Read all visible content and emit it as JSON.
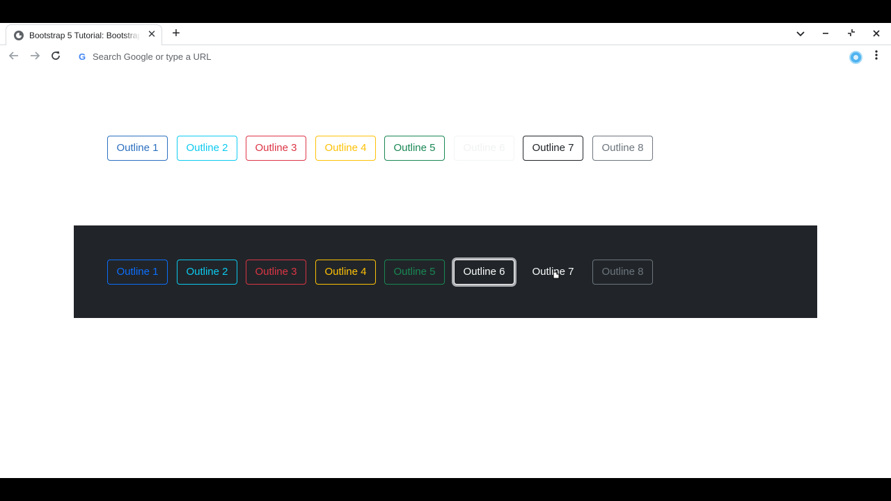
{
  "browser": {
    "tab_title": "Bootstrap 5 Tutorial: Bootstrap",
    "tab_close": "✕",
    "new_tab": "+",
    "omnibox_placeholder": "Search Google or type a URL",
    "omnibox_g": "G"
  },
  "light_row": [
    {
      "label": "Outline 1",
      "color": "#0d6efd"
    },
    {
      "label": "Outline 2",
      "color": "#0dcaf0"
    },
    {
      "label": "Outline 3",
      "color": "#dc3545"
    },
    {
      "label": "Outline 4",
      "color": "#ffc107"
    },
    {
      "label": "Outline 5",
      "color": "#198754"
    },
    {
      "label": "Outline 6",
      "color": "#f8f9fa"
    },
    {
      "label": "Outline 7",
      "color": "#212529"
    },
    {
      "label": "Outline 8",
      "color": "#6c757d"
    }
  ],
  "dark_row": [
    {
      "label": "Outline 1",
      "color": "#0d6efd"
    },
    {
      "label": "Outline 2",
      "color": "#0dcaf0"
    },
    {
      "label": "Outline 3",
      "color": "#dc3545"
    },
    {
      "label": "Outline 4",
      "color": "#ffc107"
    },
    {
      "label": "Outline 5",
      "color": "#198754"
    },
    {
      "label": "Outline 6",
      "color": "#f8f9fa"
    },
    {
      "label": "Outline 7",
      "color": "#212529"
    },
    {
      "label": "Outline 8",
      "color": "#6c757d"
    }
  ],
  "colors": {
    "dark_panel": "#212529",
    "page_bg": "#ffffff"
  }
}
